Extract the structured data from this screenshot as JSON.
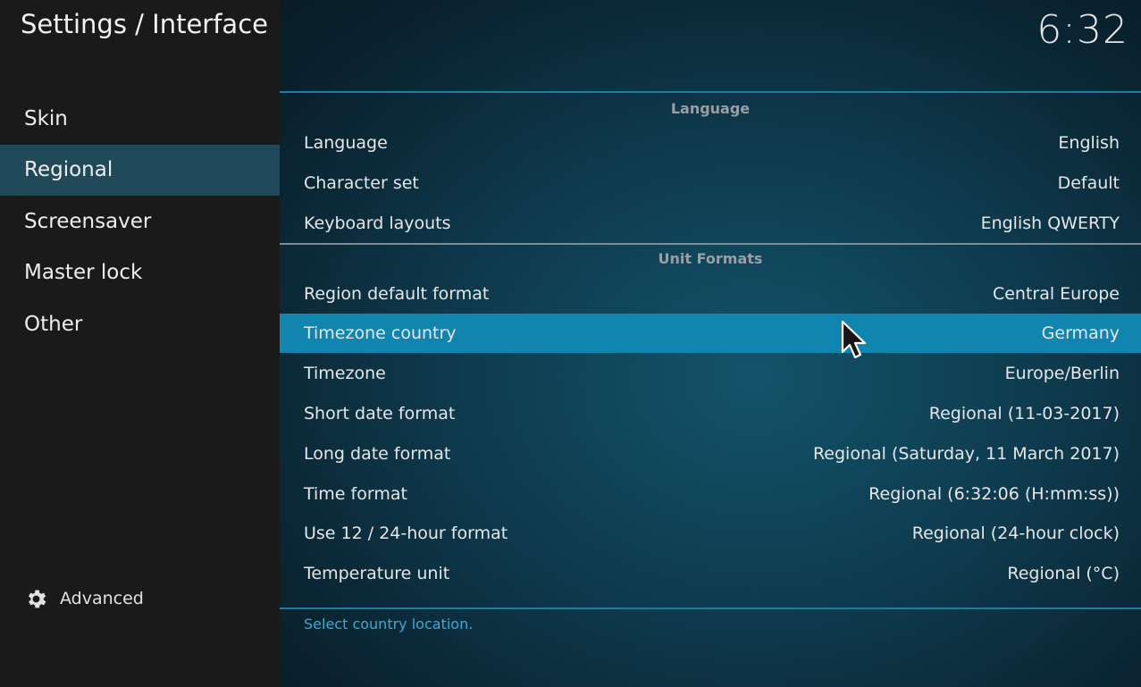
{
  "header": {
    "title": "Settings / Interface",
    "clock": "6:32"
  },
  "sidebar": {
    "items": [
      {
        "label": "Skin",
        "active": false
      },
      {
        "label": "Regional",
        "active": true
      },
      {
        "label": "Screensaver",
        "active": false
      },
      {
        "label": "Master lock",
        "active": false
      },
      {
        "label": "Other",
        "active": false
      }
    ],
    "advanced": {
      "label": "Advanced",
      "icon": "gear-icon"
    }
  },
  "sections": {
    "language": {
      "title": "Language",
      "rows": [
        {
          "label": "Language",
          "value": "English"
        },
        {
          "label": "Character set",
          "value": "Default"
        },
        {
          "label": "Keyboard layouts",
          "value": "English QWERTY"
        }
      ]
    },
    "unit_formats": {
      "title": "Unit Formats",
      "rows": [
        {
          "label": "Region default format",
          "value": "Central Europe"
        },
        {
          "label": "Timezone country",
          "value": "Germany"
        },
        {
          "label": "Timezone",
          "value": "Europe/Berlin"
        },
        {
          "label": "Short date format",
          "value": "Regional (11-03-2017)"
        },
        {
          "label": "Long date format",
          "value": "Regional (Saturday, 11 March 2017)"
        },
        {
          "label": "Time format",
          "value": "Regional (6:32:06 (H:mm:ss))"
        },
        {
          "label": "Use 12 / 24-hour format",
          "value": "Regional (24-hour clock)"
        },
        {
          "label": "Temperature unit",
          "value": "Regional (°C)"
        }
      ]
    }
  },
  "footer": {
    "hint": "Select country location."
  },
  "colors": {
    "accent": "#1085b0",
    "sidebar_bg": "#1a1a1a",
    "sidebar_active": "#20495a",
    "hint": "#3ea9d2"
  }
}
